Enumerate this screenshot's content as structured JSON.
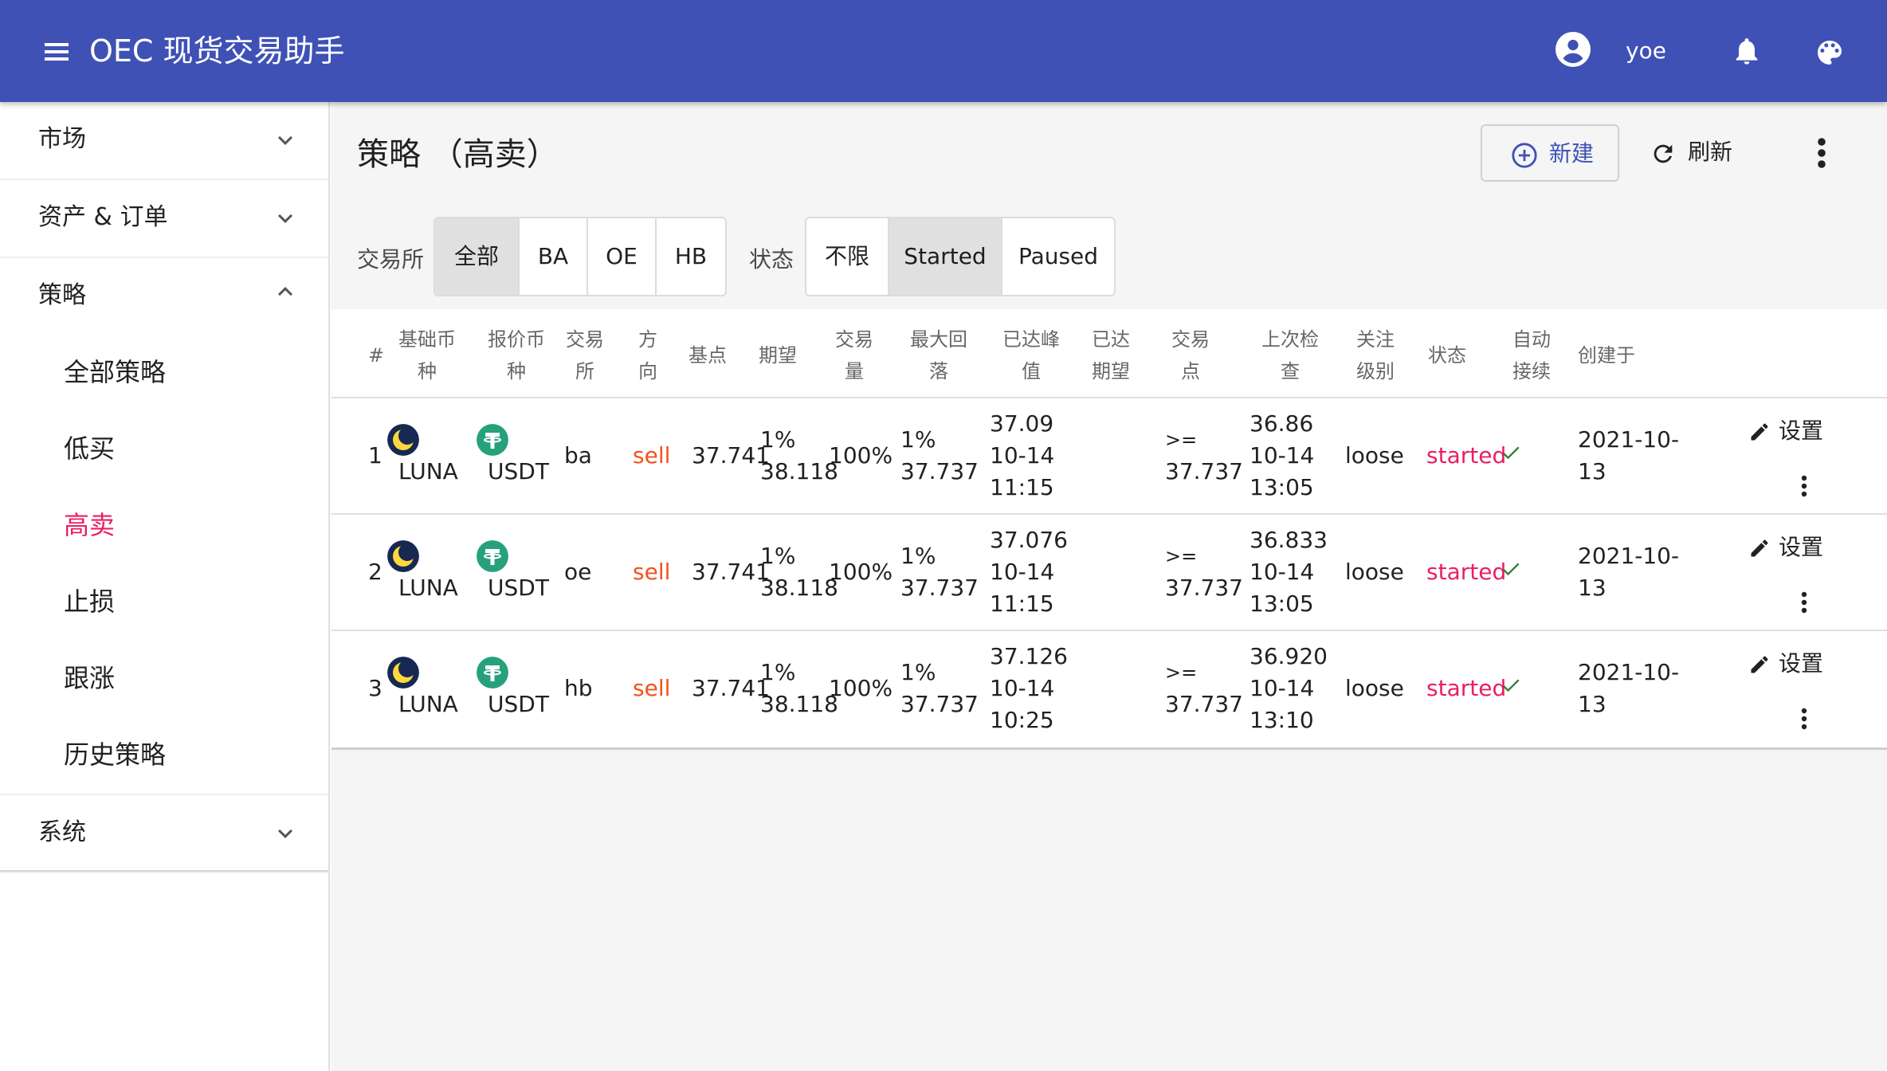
{
  "app": {
    "title": "OEC 现货交易助手",
    "user_name": "yoe"
  },
  "colors": {
    "primary": "#3f51b5",
    "accent": "#e91e63",
    "sell": "#f4511e",
    "check": "#2e7d32"
  },
  "sidebar": {
    "groups": [
      {
        "label": "市场",
        "icon": "chevron-down-icon"
      },
      {
        "label": "资产 & 订单",
        "icon": "chevron-down-icon"
      },
      {
        "label": "策略",
        "icon": "chevron-up-icon"
      },
      {
        "label": "系统",
        "icon": "chevron-down-icon"
      }
    ],
    "strategy_items": [
      "全部策略",
      "低买",
      "高卖",
      "止损",
      "跟涨",
      "历史策略"
    ],
    "active_item": "高卖"
  },
  "main": {
    "page_title": "策略 （高卖）",
    "new_label": "新建",
    "refresh_label": "刷新",
    "filters": {
      "exchange_label": "交易所",
      "exchange_options": [
        "全部",
        "BA",
        "OE",
        "HB"
      ],
      "exchange_selected": "全部",
      "status_label": "状态",
      "status_options": [
        "不限",
        "Started",
        "Paused"
      ],
      "status_selected": "Started"
    }
  },
  "table": {
    "headers": {
      "index": "#",
      "base_1": "基础币",
      "base_2": "种",
      "quote_1": "报价币",
      "quote_2": "种",
      "exch_1": "交易",
      "exch_2": "所",
      "dir_1": "方",
      "dir_2": "向",
      "basis": "基点",
      "expect": "期望",
      "vol_1": "交易",
      "vol_2": "量",
      "drawdown_1": "最大回",
      "drawdown_2": "落",
      "peak_1": "已达峰",
      "peak_2": "值",
      "reached_1": "已达",
      "reached_2": "期望",
      "tradept_1": "交易",
      "tradept_2": "点",
      "lastcheck_1": "上次检",
      "lastcheck_2": "查",
      "focus_1": "关注",
      "focus_2": "级别",
      "status": "状态",
      "auto_1": "自动",
      "auto_2": "接续",
      "created": "创建于"
    },
    "rows": [
      {
        "index": "1",
        "base": "LUNA",
        "quote": "USDT",
        "exchange": "ba",
        "direction": "sell",
        "basis": "37.741",
        "expect_pct": "1%",
        "expect_val": "38.118",
        "volume": "100%",
        "drawdown_pct": "1%",
        "drawdown_val": "37.737",
        "peak_val": "37.09",
        "peak_date": "10-14",
        "peak_time": "11:15",
        "trade_op": ">=",
        "trade_val": "37.737",
        "check_val": "36.86",
        "check_date": "10-14",
        "check_time": "13:05",
        "focus": "loose",
        "status": "started",
        "created_1": "2021-10-",
        "created_2": "13",
        "setting_label": "设置"
      },
      {
        "index": "2",
        "base": "LUNA",
        "quote": "USDT",
        "exchange": "oe",
        "direction": "sell",
        "basis": "37.741",
        "expect_pct": "1%",
        "expect_val": "38.118",
        "volume": "100%",
        "drawdown_pct": "1%",
        "drawdown_val": "37.737",
        "peak_val": "37.076",
        "peak_date": "10-14",
        "peak_time": "11:15",
        "trade_op": ">=",
        "trade_val": "37.737",
        "check_val": "36.833",
        "check_date": "10-14",
        "check_time": "13:05",
        "focus": "loose",
        "status": "started",
        "created_1": "2021-10-",
        "created_2": "13",
        "setting_label": "设置"
      },
      {
        "index": "3",
        "base": "LUNA",
        "quote": "USDT",
        "exchange": "hb",
        "direction": "sell",
        "basis": "37.741",
        "expect_pct": "1%",
        "expect_val": "38.118",
        "volume": "100%",
        "drawdown_pct": "1%",
        "drawdown_val": "37.737",
        "peak_val": "37.126",
        "peak_date": "10-14",
        "peak_time": "10:25",
        "trade_op": ">=",
        "trade_val": "37.737",
        "check_val": "36.920",
        "check_date": "10-14",
        "check_time": "13:10",
        "focus": "loose",
        "status": "started",
        "created_1": "2021-10-",
        "created_2": "13",
        "setting_label": "设置"
      }
    ]
  }
}
